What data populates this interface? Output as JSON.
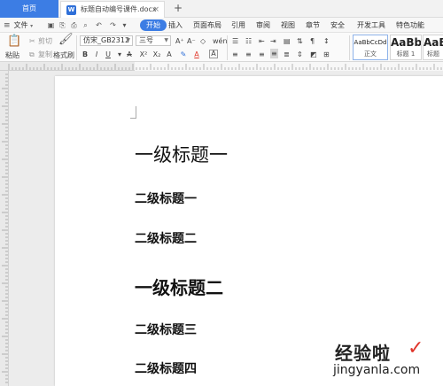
{
  "tabs": {
    "home_label": "首页",
    "doc_label": "标题自动编号课件.docx",
    "doc_icon": "W"
  },
  "menu": {
    "file_label": "文件",
    "items": [
      "开始",
      "插入",
      "页面布局",
      "引用",
      "审阅",
      "视图",
      "章节",
      "安全",
      "开发工具",
      "特色功能"
    ],
    "active_index": 0
  },
  "ribbon": {
    "paste_label": "粘贴",
    "cut_label": "剪切",
    "copy_label": "复制",
    "format_painter_label": "格式刷",
    "font_name": "仿宋_GB2312",
    "font_size": "三号",
    "styles": [
      {
        "sample": "AaBbCcDd",
        "name": "正文"
      },
      {
        "sample": "AaBb",
        "name": "标题 1"
      },
      {
        "sample": "AaB",
        "name": "标题"
      }
    ]
  },
  "document": {
    "headings": [
      {
        "text": "一级标题一",
        "level": 1
      },
      {
        "text": "二级标题一",
        "level": 2
      },
      {
        "text": "二级标题二",
        "level": 2
      },
      {
        "text": "一级标题二",
        "level": 1
      },
      {
        "text": "二级标题三",
        "level": 2
      },
      {
        "text": "二级标题四",
        "level": 2
      }
    ]
  },
  "watermark": {
    "text": "经验啦",
    "url": "jingyanla.com"
  },
  "colors": {
    "accent": "#3c7de4",
    "watermark_check": "#e0352b"
  }
}
